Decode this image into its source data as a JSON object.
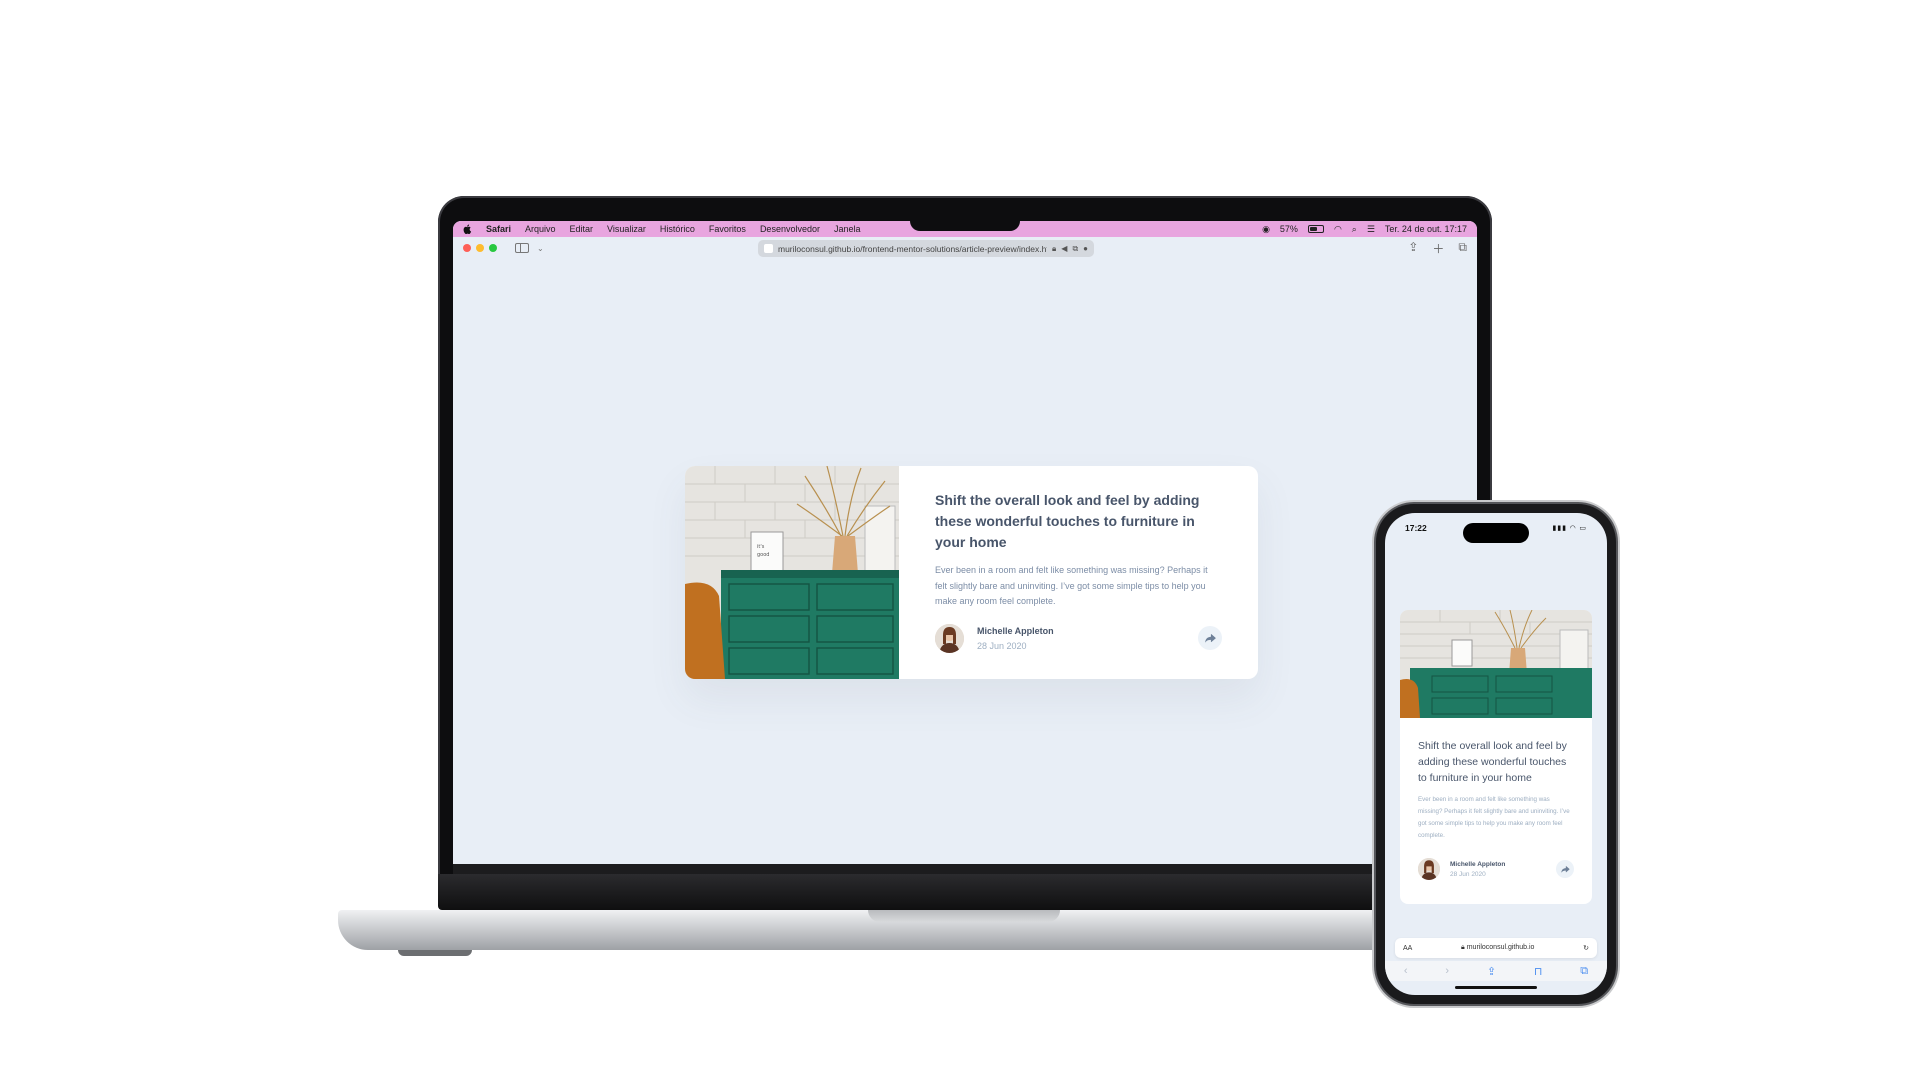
{
  "laptop": {
    "menubar": {
      "items": [
        "Safari",
        "Arquivo",
        "Editar",
        "Visualizar",
        "Histórico",
        "Favoritos",
        "Desenvolvedor",
        "Janela"
      ],
      "battery_percent": "57%",
      "battery_level": 0.57,
      "datetime": "Ter. 24 de out.  17:17",
      "background": "#e8a5df"
    },
    "browser": {
      "url": "muriloconsul.github.io/frontend-mentor-solutions/article-preview/index.htm"
    }
  },
  "article": {
    "title": "Shift the overall look and feel by adding these wonderful touches to furniture in your home",
    "description": "Ever been in a room and felt like something was missing? Perhaps it felt slightly bare and uninviting. I’ve got some simple tips to help you make any room feel complete.",
    "author_name": "Michelle Appleton",
    "author_date": "28 Jun 2020"
  },
  "phone": {
    "time": "17:22",
    "url": "muriloconsul.github.io",
    "reader_label": "AA"
  },
  "colors": {
    "page_bg": "#e8eef6",
    "title": "#48556a",
    "text": "#7c8da6",
    "dresser": "#1f7a63",
    "pillow": "#c07020"
  },
  "icons": [
    "apple-icon",
    "battery-icon",
    "wifi-icon",
    "search-icon",
    "share-icon",
    "new-tab-icon",
    "tabs-icon",
    "lock-icon",
    "reload-icon",
    "back-icon",
    "forward-icon",
    "bookmarks-icon"
  ]
}
